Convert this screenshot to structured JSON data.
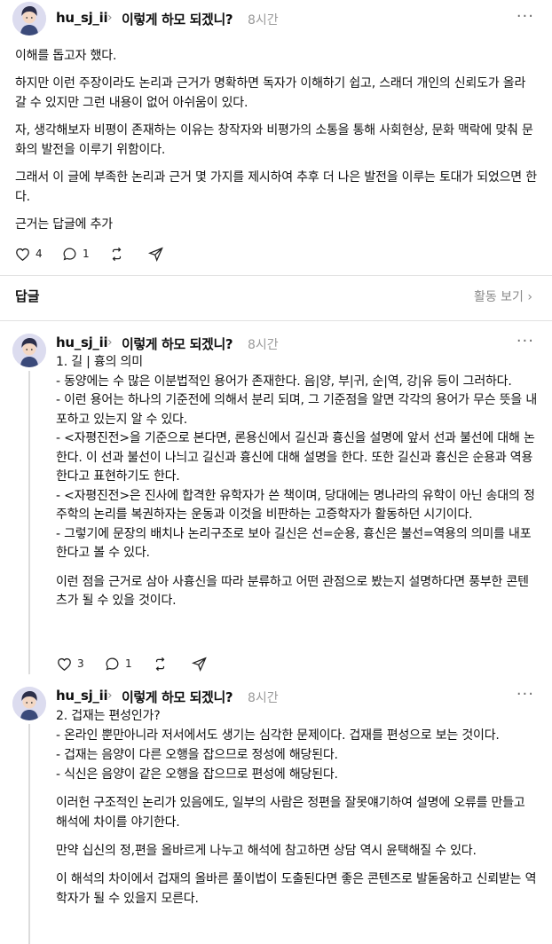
{
  "post": {
    "username": "hu_sj_ii",
    "thread_title": "이렇게 하모 되겠니?",
    "time": "8시간",
    "paragraphs": [
      "이해를 돕고자 했다.",
      "하지만 이런 주장이라도 논리과 근거가 명확하면 독자가 이해하기 쉽고, 스래더 개인의 신뢰도가 올라 갈 수 있지만 그런 내용이 없어 아쉬움이 있다.",
      "자, 생각해보자 비평이 존재하는 이유는 창작자와 비평가의 소통을 통해 사회현상, 문화 맥락에 맞춰 문화의 발전을 이루기 위함이다.",
      "그래서 이 글에 부족한 논리과 근거 몇 가지를 제시하여 추후 더 나은 발전을 이루는 토대가 되었으면 한다.",
      "근거는 답글에 추가"
    ],
    "likes": "4",
    "comments": "1"
  },
  "replies_header": {
    "label": "답글",
    "activity_link": "활동 보기"
  },
  "replies": [
    {
      "username": "hu_sj_ii",
      "thread_title": "이렇게 하모 되겠니?",
      "time": "8시간",
      "paragraphs": [
        "1. 길 | 흉의 의미\n- 동양에는 수 많은 이분법적인 용어가 존재한다. 음|양, 부|귀, 순|역, 강|유 등이 그러하다.\n- 이런 용어는 하나의 기준전에 의해서 분리 되며, 그 기준점을 알면 각각의 용어가 무슨 뜻을 내포하고 있는지 알 수 있다.\n- <자평진전>을 기준으로 본다면, 론용신에서 길신과 흉신을 설명에 앞서 선과 불선에 대해 논한다. 이 선과 불선이 나늬고 길신과 흉신에 대해 설명을 한다. 또한 길신과 흉신은 순용과 역용한다고 표현하기도 한다.\n- <자평진전>은 진사에 합격한 유학자가 쓴 책이며, 당대에는 명나라의 유학이 아닌 송대의 정주학의 논리를 복권하자는 운동과 이것을 비판하는 고증학자가 활동하던 시기이다.\n- 그렇기에 문장의 배치나 논리구조로 보아 길신은 선=순용, 흉신은 불선=역용의 의미를 내포한다고 볼 수 있다.",
        "이런 점을 근거로 삼아 사흉신을 따라 분류하고 어떤 관점으로 봤는지 설명하다면 풍부한 콘텐츠가 될 수 있을 것이다."
      ],
      "likes": "3",
      "comments": "1"
    },
    {
      "username": "hu_sj_ii",
      "thread_title": "이렇게 하모 되겠니?",
      "time": "8시간",
      "paragraphs": [
        "2. 겁재는 편성인가?\n- 온라인 뿐만아니라 저서에서도 생기는 심각한 문제이다. 겁재를 편성으로 보는 것이다.\n- 겁재는 음양이 다른 오행을 잡으므로 정성에 해당된다.\n- 식신은 음양이 같은 오행을 잡으므로 편성에 해당된다.",
        "이러헌 구조적인 논리가 있음에도, 일부의 사람은 정편을 잘못얘기하여 설명에 오류를 만들고 해석에 차이를 야기한다.",
        "만약 십신의 정,편을 올바르게 나누고 해석에 참고하면 상담 역시 윤택해질 수 있다.",
        "이 해석의 차이에서 겁재의 올바른 풀이법이 도출된다면 좋은 콘텐즈로 발돋움하고 신뢰받는 역학자가 될 수 있을지 모른다."
      ]
    }
  ]
}
